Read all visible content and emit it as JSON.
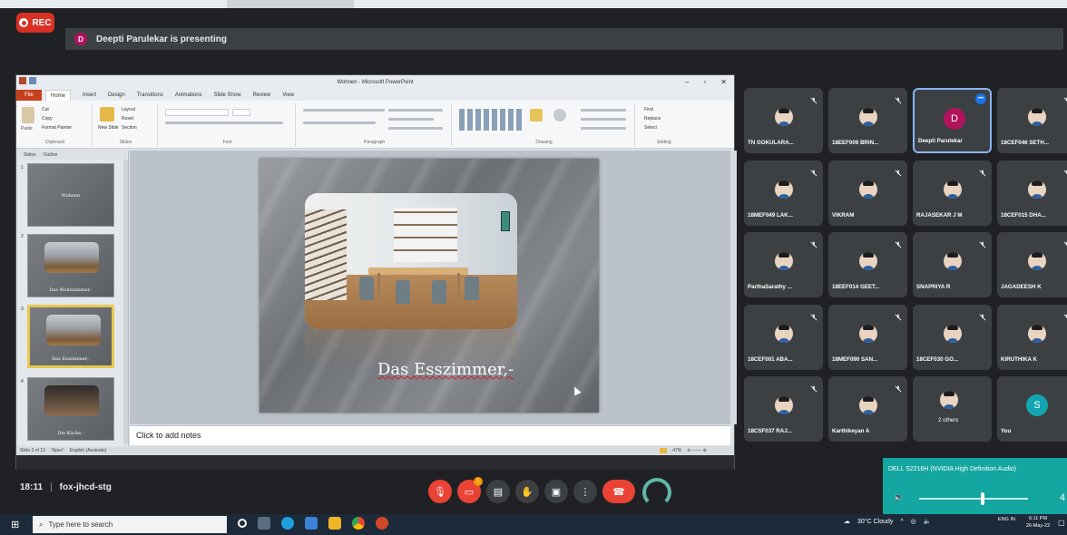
{
  "recording": {
    "label": "REC"
  },
  "presenter_banner": {
    "initial": "D",
    "text": "Deepti Parulekar is presenting"
  },
  "ppt_window": {
    "title": "Wohnen - Microsoft PowerPoint",
    "menu": [
      "File",
      "Home",
      "Insert",
      "Design",
      "Transitions",
      "Animations",
      "Slide Show",
      "Review",
      "View"
    ],
    "ribbon_groups": [
      "Clipboard",
      "Slides",
      "Font",
      "Paragraph",
      "Drawing",
      "Editing"
    ],
    "ribbon_items": {
      "cut": "Cut",
      "copy": "Copy",
      "format_painter": "Format Painter",
      "paste": "Paste",
      "new_slide": "New Slide",
      "layout": "Layout",
      "reset": "Reset",
      "section": "Section",
      "find": "Find",
      "replace": "Replace",
      "select": "Select"
    },
    "pane_tabs": [
      "Slides",
      "Outline"
    ],
    "thumbnails": [
      {
        "num": "1",
        "caption": "Wohnen"
      },
      {
        "num": "2",
        "caption": "Das Wohnzimmer,-"
      },
      {
        "num": "3",
        "caption": "Das Esszimmer,-"
      },
      {
        "num": "4",
        "caption": "Die Küche,-"
      }
    ],
    "slide_title": "Das Esszimmer,-",
    "notes_placeholder": "Click to add notes",
    "status": {
      "slide": "Slide 3 of 13",
      "theme": "\"Apex\"",
      "language": "English (Australia)",
      "zoom": "47%"
    }
  },
  "participants": [
    {
      "name": "TN GOKULARA...",
      "type": "photo"
    },
    {
      "name": "18EEF009 BRIN...",
      "type": "photo"
    },
    {
      "name": "Deepti Parulekar",
      "type": "letter",
      "letter": "D",
      "color": "#b0135b",
      "active": true
    },
    {
      "name": "18CEF046 SETH...",
      "type": "photo"
    },
    {
      "name": "18MEF049 LAK...",
      "type": "photo"
    },
    {
      "name": "VIKRAM",
      "type": "photo"
    },
    {
      "name": "RAJASEKAR J M",
      "type": "photo"
    },
    {
      "name": "18CEF015 DHA...",
      "type": "photo"
    },
    {
      "name": "ParthaSarathy ...",
      "type": "photo"
    },
    {
      "name": "18EEF014 GEET...",
      "type": "photo"
    },
    {
      "name": "SNAPRIYA R",
      "type": "photo"
    },
    {
      "name": "JAGADEESH K",
      "type": "photo"
    },
    {
      "name": "18CEF001 ABA...",
      "type": "photo"
    },
    {
      "name": "18MEF090 SAN...",
      "type": "photo"
    },
    {
      "name": "18CEF030 GO...",
      "type": "photo"
    },
    {
      "name": "KIRUTHIKA K",
      "type": "photo"
    },
    {
      "name": "18CSF037 RAJ...",
      "type": "photo"
    },
    {
      "name": "Karthikeyan A",
      "type": "photo"
    },
    {
      "name": "2 others",
      "type": "group"
    },
    {
      "name": "You",
      "type": "letter",
      "letter": "S",
      "color": "#12a4af"
    }
  ],
  "audio_popup": {
    "device": "DELL S2216H (NVIDIA High Definition Audio)",
    "volume": "4"
  },
  "meeting": {
    "time": "18:11",
    "code": "fox-jhcd-stg"
  },
  "taskbar": {
    "search_placeholder": "Type here to search",
    "weather": "30°C Cloudy",
    "lang": "ENG IN",
    "time": "6:11 PM",
    "date": "26-May-22"
  },
  "colors": {
    "meet_bg": "#202124",
    "tile_bg": "#3c4043",
    "end_call": "#ea4335",
    "audio_popup": "#14a6a0",
    "ppt_file_tab": "#c5401c"
  }
}
